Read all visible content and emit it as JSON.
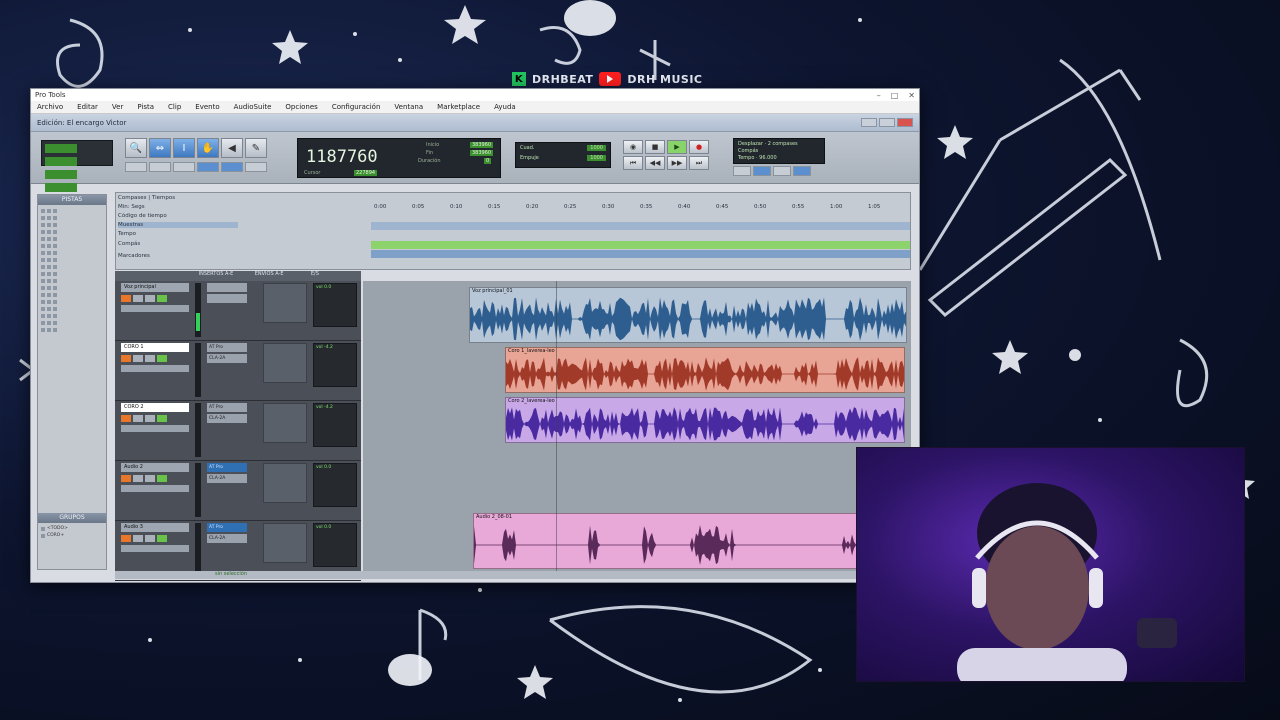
{
  "overlay": {
    "brand_left": "DRHBEAT",
    "brand_right": "DRH MUSIC"
  },
  "window": {
    "app_title": "Pro Tools",
    "menu": [
      "Archivo",
      "Editar",
      "Ver",
      "Pista",
      "Clip",
      "Evento",
      "AudioSuite",
      "Opciones",
      "Configuración",
      "Ventana",
      "Marketplace",
      "Ayuda"
    ],
    "edit_title": "Edición: El encargo Victor"
  },
  "counter": {
    "main": "1187760",
    "inicio_label": "Inicio",
    "fin_label": "Fin",
    "duracion_label": "Duración",
    "inicio": "383960",
    "fin": "383960",
    "duracion": "0",
    "cursor_label": "Cursor",
    "cursor": "227894"
  },
  "nudge": {
    "grid_label": "Cuad.",
    "grid_value": "1000",
    "nudge_label": "Empuje",
    "nudge_value": "1000"
  },
  "midi": {
    "line1": "Desplazar",
    "line2": "Compás",
    "line3": "Tempo",
    "bars": "2 compases",
    "tempo": "96.000"
  },
  "rulers": [
    "Compases | Tiempos",
    "Min: Segs",
    "Código de tiempo",
    "Muestras",
    "Tempo",
    "Compás",
    "Marcadores"
  ],
  "ruler_ticks": [
    "0:00",
    "0:05",
    "0:10",
    "0:15",
    "0:20",
    "0:25",
    "0:30",
    "0:35",
    "0:40",
    "0:45",
    "0:50",
    "0:55",
    "1:00",
    "1:05"
  ],
  "panels": {
    "tracks_title": "PISTAS",
    "groups_title": "GRUPOS",
    "groups": [
      "<TODO>",
      "CORO+"
    ]
  },
  "mixer_headers": [
    "INSERTOS A-E",
    "ENVIOS A-E",
    "E/S"
  ],
  "tracks": [
    {
      "name": "Voz principal",
      "io_in": "",
      "io_out": "",
      "vol": "vol  0.0"
    },
    {
      "name": "CORO 1",
      "io_in": "AT Pro",
      "io_out": "CLA-2A",
      "vol": "vol  -4.2"
    },
    {
      "name": "CORO 2",
      "io_in": "AT Pro",
      "io_out": "CLA-2A",
      "vol": "vol  -4.2"
    },
    {
      "name": "Audio 2",
      "io_in": "AT Pro",
      "io_out": "CLA-2A",
      "vol": "vol  0.0"
    },
    {
      "name": "Audio 3",
      "io_in": "AT Pro",
      "io_out": "CLA-2A",
      "vol": "vol  0.0"
    }
  ],
  "clips": {
    "voice": "Voz principal_01",
    "coro1": "Coro 1_laverea-leo",
    "coro2": "Coro 2_laverea-leo",
    "audio2": "Audio 2_08-01"
  },
  "status": "sin selección",
  "colors": {
    "voice_clip": "#b8c7d8",
    "coro1_clip": "#e8a596",
    "coro2_clip": "#c9a8e8",
    "audio2_clip": "#e8a8d8",
    "marker_bar": "#8cd36b"
  }
}
